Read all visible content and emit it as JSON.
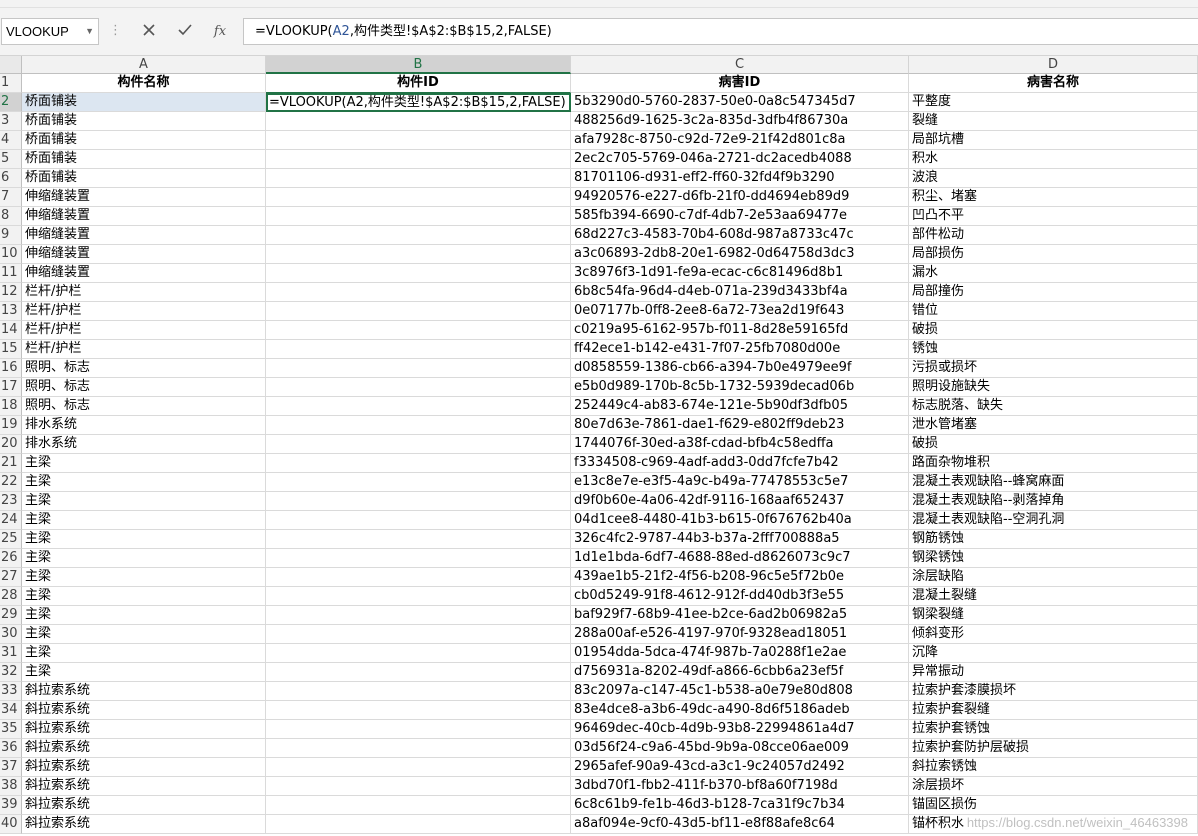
{
  "name_box": {
    "value": "VLOOKUP"
  },
  "formula_bar": {
    "prefix": "=VLOOKUP(",
    "ref": "A2",
    "suffix": ",构件类型!$A$2:$B$15,2,FALSE)",
    "cancel_icon": "close-icon",
    "enter_icon": "checkmark-icon",
    "fx_label": "fx"
  },
  "columns": [
    "A",
    "B",
    "C",
    "D"
  ],
  "header_row": {
    "num": "1",
    "a": "构件名称",
    "b": "构件ID",
    "c": "病害ID",
    "d": "病害名称"
  },
  "rows": [
    {
      "num": "2",
      "a": "桥面铺装",
      "b": "=VLOOKUP(A2,构件类型!$A$2:$B$15,2,FALSE)",
      "c": "5b3290d0-5760-2837-50e0-0a8c547345d7",
      "d": "平整度"
    },
    {
      "num": "3",
      "a": "桥面铺装",
      "b": "",
      "c": "488256d9-1625-3c2a-835d-3dfb4f86730a",
      "d": "裂缝"
    },
    {
      "num": "4",
      "a": "桥面铺装",
      "b": "",
      "c": "afa7928c-8750-c92d-72e9-21f42d801c8a",
      "d": "局部坑槽"
    },
    {
      "num": "5",
      "a": "桥面铺装",
      "b": "",
      "c": "2ec2c705-5769-046a-2721-dc2acedb4088",
      "d": "积水"
    },
    {
      "num": "6",
      "a": "桥面铺装",
      "b": "",
      "c": "81701106-d931-eff2-ff60-32fd4f9b3290",
      "d": "波浪"
    },
    {
      "num": "7",
      "a": "伸缩缝装置",
      "b": "",
      "c": "94920576-e227-d6fb-21f0-dd4694eb89d9",
      "d": "积尘、堵塞"
    },
    {
      "num": "8",
      "a": "伸缩缝装置",
      "b": "",
      "c": "585fb394-6690-c7df-4db7-2e53aa69477e",
      "d": "凹凸不平"
    },
    {
      "num": "9",
      "a": "伸缩缝装置",
      "b": "",
      "c": "68d227c3-4583-70b4-608d-987a8733c47c",
      "d": "部件松动"
    },
    {
      "num": "10",
      "a": "伸缩缝装置",
      "b": "",
      "c": "a3c06893-2db8-20e1-6982-0d64758d3dc3",
      "d": "局部损伤"
    },
    {
      "num": "11",
      "a": "伸缩缝装置",
      "b": "",
      "c": "3c8976f3-1d91-fe9a-ecac-c6c81496d8b1",
      "d": "漏水"
    },
    {
      "num": "12",
      "a": "栏杆/护栏",
      "b": "",
      "c": "6b8c54fa-96d4-d4eb-071a-239d3433bf4a",
      "d": "局部撞伤"
    },
    {
      "num": "13",
      "a": "栏杆/护栏",
      "b": "",
      "c": "0e07177b-0ff8-2ee8-6a72-73ea2d19f643",
      "d": "错位"
    },
    {
      "num": "14",
      "a": "栏杆/护栏",
      "b": "",
      "c": "c0219a95-6162-957b-f011-8d28e59165fd",
      "d": "破损"
    },
    {
      "num": "15",
      "a": "栏杆/护栏",
      "b": "",
      "c": "ff42ece1-b142-e431-7f07-25fb7080d00e",
      "d": "锈蚀"
    },
    {
      "num": "16",
      "a": "照明、标志",
      "b": "",
      "c": "d0858559-1386-cb66-a394-7b0e4979ee9f",
      "d": "污损或损坏"
    },
    {
      "num": "17",
      "a": "照明、标志",
      "b": "",
      "c": "e5b0d989-170b-8c5b-1732-5939decad06b",
      "d": "照明设施缺失"
    },
    {
      "num": "18",
      "a": "照明、标志",
      "b": "",
      "c": "252449c4-ab83-674e-121e-5b90df3dfb05",
      "d": "标志脱落、缺失"
    },
    {
      "num": "19",
      "a": "排水系统",
      "b": "",
      "c": "80e7d63e-7861-dae1-f629-e802ff9deb23",
      "d": "泄水管堵塞"
    },
    {
      "num": "20",
      "a": "排水系统",
      "b": "",
      "c": "1744076f-30ed-a38f-cdad-bfb4c58edffa",
      "d": "破损"
    },
    {
      "num": "21",
      "a": "主梁",
      "b": "",
      "c": "f3334508-c969-4adf-add3-0dd7fcfe7b42",
      "d": "路面杂物堆积"
    },
    {
      "num": "22",
      "a": "主梁",
      "b": "",
      "c": "e13c8e7e-e3f5-4a9c-b49a-77478553c5e7",
      "d": "混凝土表观缺陷--蜂窝麻面"
    },
    {
      "num": "23",
      "a": "主梁",
      "b": "",
      "c": "d9f0b60e-4a06-42df-9116-168aaf652437",
      "d": "混凝土表观缺陷--剥落掉角"
    },
    {
      "num": "24",
      "a": "主梁",
      "b": "",
      "c": "04d1cee8-4480-41b3-b615-0f676762b40a",
      "d": "混凝土表观缺陷--空洞孔洞"
    },
    {
      "num": "25",
      "a": "主梁",
      "b": "",
      "c": "326c4fc2-9787-44b3-b37a-2fff700888a5",
      "d": "钢筋锈蚀"
    },
    {
      "num": "26",
      "a": "主梁",
      "b": "",
      "c": "1d1e1bda-6df7-4688-88ed-d8626073c9c7",
      "d": "钢梁锈蚀"
    },
    {
      "num": "27",
      "a": "主梁",
      "b": "",
      "c": "439ae1b5-21f2-4f56-b208-96c5e5f72b0e",
      "d": "涂层缺陷"
    },
    {
      "num": "28",
      "a": "主梁",
      "b": "",
      "c": "cb0d5249-91f8-4612-912f-dd40db3f3e55",
      "d": "混凝土裂缝"
    },
    {
      "num": "29",
      "a": "主梁",
      "b": "",
      "c": "baf929f7-68b9-41ee-b2ce-6ad2b06982a5",
      "d": "钢梁裂缝"
    },
    {
      "num": "30",
      "a": "主梁",
      "b": "",
      "c": "288a00af-e526-4197-970f-9328ead18051",
      "d": "倾斜变形"
    },
    {
      "num": "31",
      "a": "主梁",
      "b": "",
      "c": "01954dda-5dca-474f-987b-7a0288f1e2ae",
      "d": "沉降"
    },
    {
      "num": "32",
      "a": "主梁",
      "b": "",
      "c": "d756931a-8202-49df-a866-6cbb6a23ef5f",
      "d": "异常振动"
    },
    {
      "num": "33",
      "a": "斜拉索系统",
      "b": "",
      "c": "83c2097a-c147-45c1-b538-a0e79e80d808",
      "d": "拉索护套漆膜损坏"
    },
    {
      "num": "34",
      "a": "斜拉索系统",
      "b": "",
      "c": "83e4dce8-a3b6-49dc-a490-8d6f5186adeb",
      "d": "拉索护套裂缝"
    },
    {
      "num": "35",
      "a": "斜拉索系统",
      "b": "",
      "c": "96469dec-40cb-4d9b-93b8-22994861a4d7",
      "d": "拉索护套锈蚀"
    },
    {
      "num": "36",
      "a": "斜拉索系统",
      "b": "",
      "c": "03d56f24-c9a6-45bd-9b9a-08cce06ae009",
      "d": "拉索护套防护层破损"
    },
    {
      "num": "37",
      "a": "斜拉索系统",
      "b": "",
      "c": "2965afef-90a9-43cd-a3c1-9c24057d2492",
      "d": "斜拉索锈蚀"
    },
    {
      "num": "38",
      "a": "斜拉索系统",
      "b": "",
      "c": "3dbd70f1-fbb2-411f-b370-bf8a60f7198d",
      "d": "涂层损坏"
    },
    {
      "num": "39",
      "a": "斜拉索系统",
      "b": "",
      "c": "6c8c61b9-fe1b-46d3-b128-7ca31f9c7b34",
      "d": "锚固区损伤"
    },
    {
      "num": "40",
      "a": "斜拉索系统",
      "b": "",
      "c": "a8af094e-9cf0-43d5-bf11-e8f88afe8c64",
      "d": "锚杯积水"
    }
  ],
  "watermark": "https://blog.csdn.net/weixin_46463398"
}
